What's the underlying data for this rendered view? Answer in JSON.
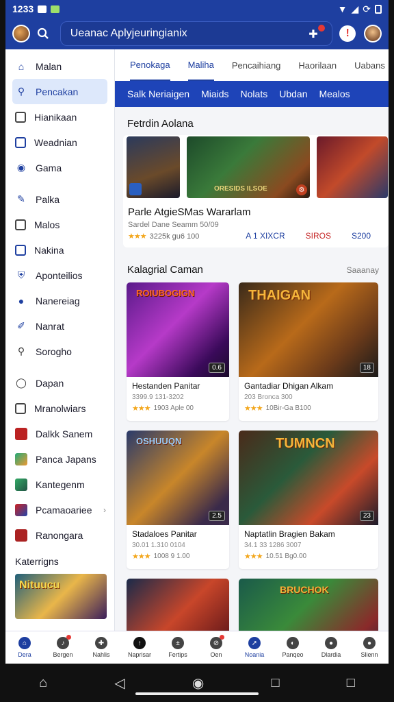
{
  "status": {
    "time": "1233"
  },
  "search": {
    "text": "Ueanac Aplyjeuringianix"
  },
  "sidebar": {
    "items": [
      {
        "label": "Malan",
        "icon": "home-icon"
      },
      {
        "label": "Pencakan",
        "icon": "search-icon"
      },
      {
        "label": "Hianikaan",
        "icon": "calendar-icon"
      },
      {
        "label": "Weadnian",
        "icon": "bookmark-icon"
      },
      {
        "label": "Gama",
        "icon": "gamepad-icon"
      },
      {
        "label": "Palka",
        "icon": "pencil-icon"
      },
      {
        "label": "Malos",
        "icon": "mail-icon"
      },
      {
        "label": "Nakina",
        "icon": "book-icon"
      },
      {
        "label": "Aponteilios",
        "icon": "shield-icon"
      },
      {
        "label": "Nanereiag",
        "icon": "user-icon"
      },
      {
        "label": "Nanrat",
        "icon": "edit-icon"
      },
      {
        "label": "Sorogho",
        "icon": "search-icon"
      },
      {
        "label": "Dapan",
        "icon": "chat-icon"
      },
      {
        "label": "Mranolwiars",
        "icon": "file-icon"
      },
      {
        "label": "Dalkk Sanem",
        "icon": "game-thumb-icon"
      },
      {
        "label": "Panca Japans",
        "icon": "game-thumb-icon"
      },
      {
        "label": "Kantegenm",
        "icon": "game-thumb-icon"
      },
      {
        "label": "Pcamaoariee",
        "icon": "game-thumb-icon"
      },
      {
        "label": "Ranongara",
        "icon": "game-thumb-icon"
      }
    ],
    "section_title": "Katerrigns",
    "thumb_title": "Nituucu"
  },
  "tabs": [
    "Penokaga",
    "Maliha",
    "Pencaihiang",
    "Haorilaan",
    "Uabans"
  ],
  "subtabs": [
    "Salk Neriaigen",
    "Miaids",
    "Nolats",
    "Ubdan",
    "Mealos"
  ],
  "featured": {
    "section": "Fetrdin Aolana",
    "title": "Parle AtgieSMas Wararlam",
    "subtitle": "Sardel Dane Seamm 50/09",
    "rating_text": "3225k gu6 100",
    "img_text": "ORESIDS ILSOE",
    "links": [
      "A 1 XIXCR",
      "SIROS",
      "S200"
    ],
    "link_colors": [
      "#1e3fa0",
      "#c62828",
      "#1e3fa0"
    ]
  },
  "kategori": {
    "title": "Kalagrial Caman",
    "more": "Saaanay",
    "cards": [
      {
        "title": "Hestanden Panitar",
        "meta": "3399.9 131-3202",
        "rating": "1903 Aple 00",
        "tag": "0.6",
        "art": "ROIUBOGIGN"
      },
      {
        "title": "Gantadiar Dhigan Alkam",
        "meta": "203 Bronca 300",
        "rating": "10Bir-Ga B100",
        "tag": "18",
        "art": "THAIGAN"
      },
      {
        "title": "Stadaloes Panitar",
        "meta": "30.01 1.310 0104",
        "rating": "1008 9 1.00",
        "tag": "2.5",
        "art": "OSHUUQN"
      },
      {
        "title": "Naptatlin Bragien Bakam",
        "meta": "34.1 33 1286 3007",
        "rating": "10.51 Bg0.00",
        "tag": "23",
        "art": "TUMNCN"
      },
      {
        "title": "",
        "meta": "",
        "rating": "",
        "tag": "",
        "art": ""
      },
      {
        "title": "",
        "meta": "",
        "rating": "",
        "tag": "",
        "art": "BRUCHOK"
      }
    ]
  },
  "bottomnav": [
    "Dera",
    "Bergen",
    "Nahlis",
    "Naprisar",
    "Fertips",
    "Oen",
    "Noania",
    "Panqeo",
    "Dlardia",
    "Slienn"
  ],
  "colors": {
    "brand": "#1e3fa0",
    "accent": "#1e44b8",
    "star": "#f3a61b"
  }
}
